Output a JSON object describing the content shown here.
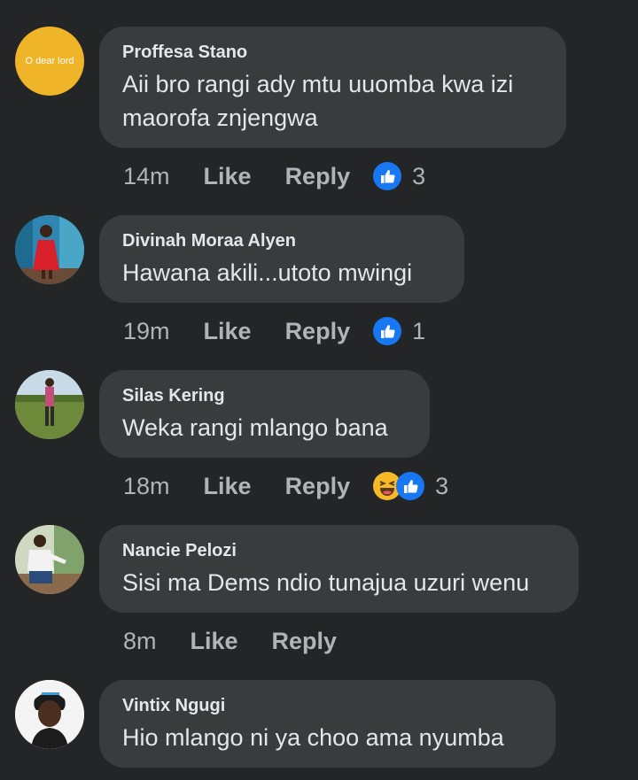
{
  "comments": [
    {
      "author": "Proffesa Stano",
      "text_lines": [
        "Aii bro rangi ady mtu uuomba kwa izi",
        "maorofa znjengwa"
      ],
      "avatar_text": "O dear lord",
      "time": "14m",
      "like_label": "Like",
      "reply_label": "Reply",
      "reactions": [
        "like-icon"
      ],
      "reaction_count": "3"
    },
    {
      "author": "Divinah Moraa Alyen",
      "text_lines": [
        "Hawana akili...utoto mwingi"
      ],
      "time": "19m",
      "like_label": "Like",
      "reply_label": "Reply",
      "reactions": [
        "like-icon"
      ],
      "reaction_count": "1"
    },
    {
      "author": "Silas Kering",
      "text_lines": [
        "Weka rangi mlango bana"
      ],
      "time": "18m",
      "like_label": "Like",
      "reply_label": "Reply",
      "reactions": [
        "haha-icon",
        "like-icon"
      ],
      "reaction_count": "3"
    },
    {
      "author": "Nancie Pelozi",
      "text_lines": [
        "Sisi ma Dems ndio tunajua uzuri wenu"
      ],
      "time": "8m",
      "like_label": "Like",
      "reply_label": "Reply",
      "reactions": [],
      "reaction_count": ""
    },
    {
      "author": "Vintix Ngugi",
      "text_lines": [
        "Hio mlango ni ya choo ama nyumba"
      ]
    }
  ],
  "colors": {
    "background": "#242526",
    "bubble": "#3a3b3c",
    "text_primary": "#e4e6eb",
    "text_secondary": "#b0b3b8",
    "like_blue": "#1877f2",
    "haha_yellow": "#f7b928",
    "avatar_yellow": "#f0b429"
  }
}
